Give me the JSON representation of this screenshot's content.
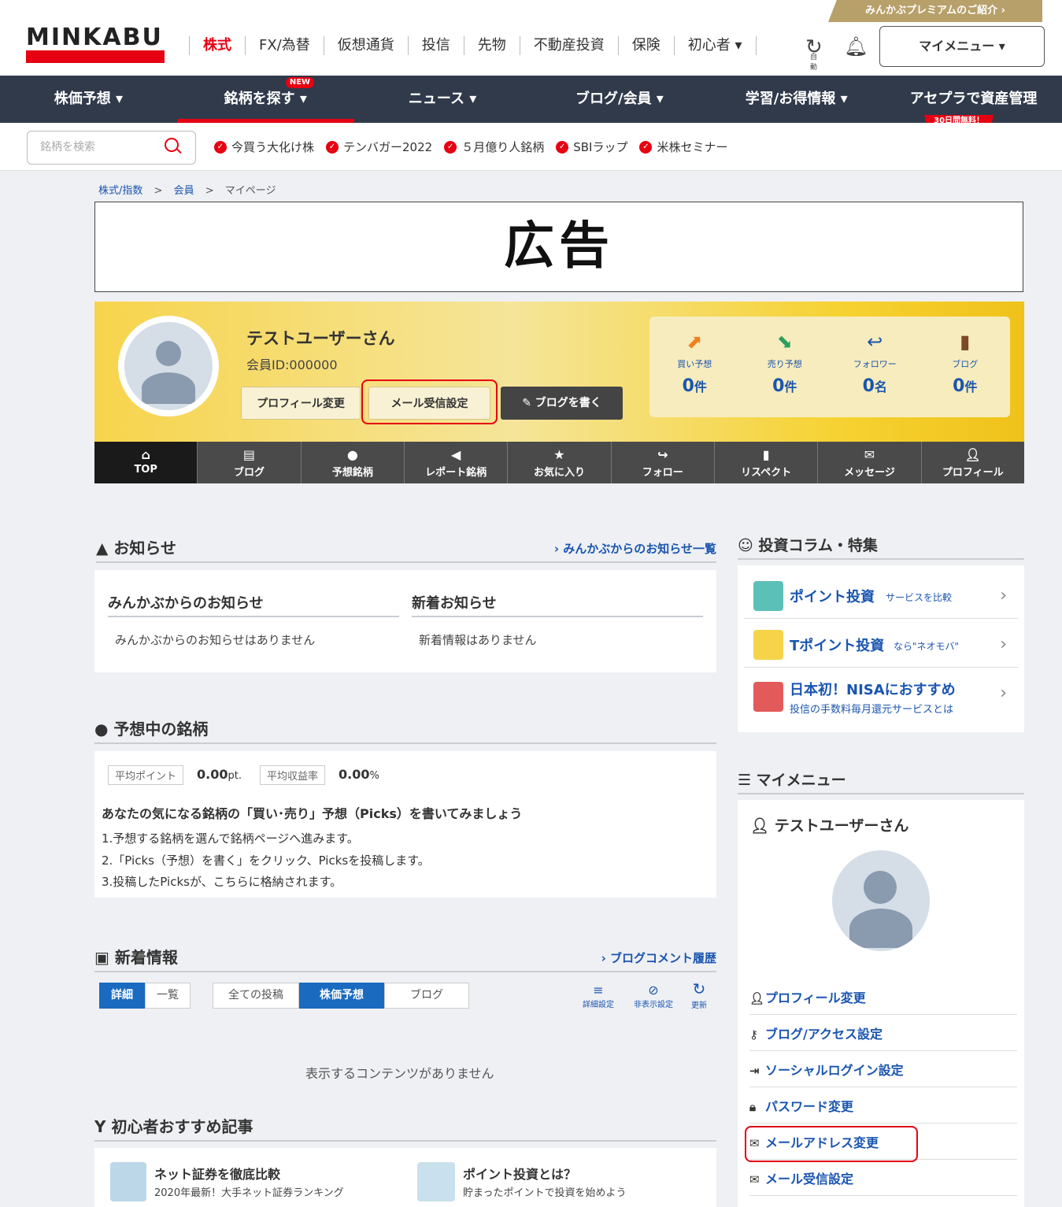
{
  "header": {
    "logo": "MINKABU",
    "premium": "みんかぶプレミアムのご紹介 ›",
    "top_nav": [
      "株式",
      "FX/為替",
      "仮想通貨",
      "投信",
      "先物",
      "不動産投資",
      "保険",
      "初心者 ▾"
    ],
    "refresh_label": "自動",
    "my_menu": "マイメニュー ▾"
  },
  "main_nav": [
    {
      "label": "株価予想 ▾"
    },
    {
      "label": "銘柄を探す ▾",
      "badge": "NEW"
    },
    {
      "label": "ニュース ▾"
    },
    {
      "label": "ブログ/会員 ▾"
    },
    {
      "label": "学習/お得情報 ▾"
    },
    {
      "label": "アセプラで資産管理",
      "badge": "30日間無料！"
    }
  ],
  "search": {
    "placeholder": "銘柄を検索"
  },
  "quick_links": [
    "今買う大化け株",
    "テンバガー2022",
    "５月億り人銘柄",
    "SBIラップ",
    "米株セミナー"
  ],
  "breadcrumb": {
    "a": "株式/指数",
    "b": "会員",
    "c": "マイページ",
    "sep": ">"
  },
  "ad": "広告",
  "profile": {
    "name": "テストユーザーさん",
    "member_id": "会員ID:000000",
    "btn_profile": "プロフィール変更",
    "btn_mail": "メール受信設定",
    "btn_blog": "✎ ブログを書く",
    "stats": [
      {
        "label": "買い予想",
        "value": "0",
        "unit": "件"
      },
      {
        "label": "売り予想",
        "value": "0",
        "unit": "件"
      },
      {
        "label": "フォロワー",
        "value": "0",
        "unit": "名"
      },
      {
        "label": "ブログ",
        "value": "0",
        "unit": "件"
      }
    ]
  },
  "tabs": [
    "TOP",
    "ブログ",
    "予想銘柄",
    "レポート銘柄",
    "お気に入り",
    "フォロー",
    "リスペクト",
    "メッセージ",
    "プロフィール"
  ],
  "notice": {
    "title": "お知らせ",
    "more": "› みんかぶからのお知らせ一覧",
    "col1_title": "みんかぶからのお知らせ",
    "col1_text": "みんかぶからのお知らせはありません",
    "col2_title": "新着お知らせ",
    "col2_text": "新着情報はありません"
  },
  "picks": {
    "title": "予想中の銘柄",
    "avg_point_label": "平均ポイント",
    "avg_point": "0.00",
    "avg_point_unit": "pt.",
    "avg_return_label": "平均収益率",
    "avg_return": "0.00",
    "avg_return_unit": "%",
    "headline": "あなたの気になる銘柄の「買い･売り」予想（Picks）を書いてみましょう",
    "step1": "1.予想する銘柄を選んで銘柄ページへ進みます。",
    "step2": "2.「Picks（予想）を書く」をクリック、Picksを投稿します。",
    "step3": "3.投稿したPicksが、こちらに格納されます。"
  },
  "news": {
    "title": "新着情報",
    "more": "› ブログコメント履歴",
    "seg1": [
      "詳細",
      "一覧"
    ],
    "seg2": [
      "全ての投稿",
      "株価予想",
      "ブログ"
    ],
    "tools": [
      "詳細設定",
      "非表示設定",
      "更新"
    ],
    "empty": "表示するコンテンツがありません"
  },
  "beginner": {
    "title": "初心者おすすめ記事",
    "items": [
      {
        "title": "ネット証券を徹底比較",
        "sub": "2020年最新！大手ネット証券ランキング"
      },
      {
        "title": "ポイント投資とは？",
        "sub": "貯まったポイントで投資を始めよう"
      }
    ]
  },
  "column": {
    "title": "投資コラム・特集",
    "items": [
      {
        "title": "ポイント投資",
        "sub": "サービスを比較",
        "color": "#5bc0b8"
      },
      {
        "title": "Tポイント投資",
        "sub": "なら\"ネオモバ\"",
        "color": "#f5d44a"
      },
      {
        "title": "日本初！NISAにおすすめ",
        "sub": "投信の手数料毎月還元サービスとは",
        "color": "#e35a5a"
      }
    ]
  },
  "my_menu": {
    "title": "マイメニュー",
    "user": "テストユーザーさん",
    "items": [
      "プロフィール変更",
      "ブログ/アクセス設定",
      "ソーシャルログイン設定",
      "パスワード変更",
      "メールアドレス変更",
      "メール受信設定"
    ]
  },
  "colors": {
    "brand_red": "#e60012",
    "nav_dark": "#303a4b",
    "link_blue": "#1a55b0",
    "highlight": "#e60012"
  }
}
